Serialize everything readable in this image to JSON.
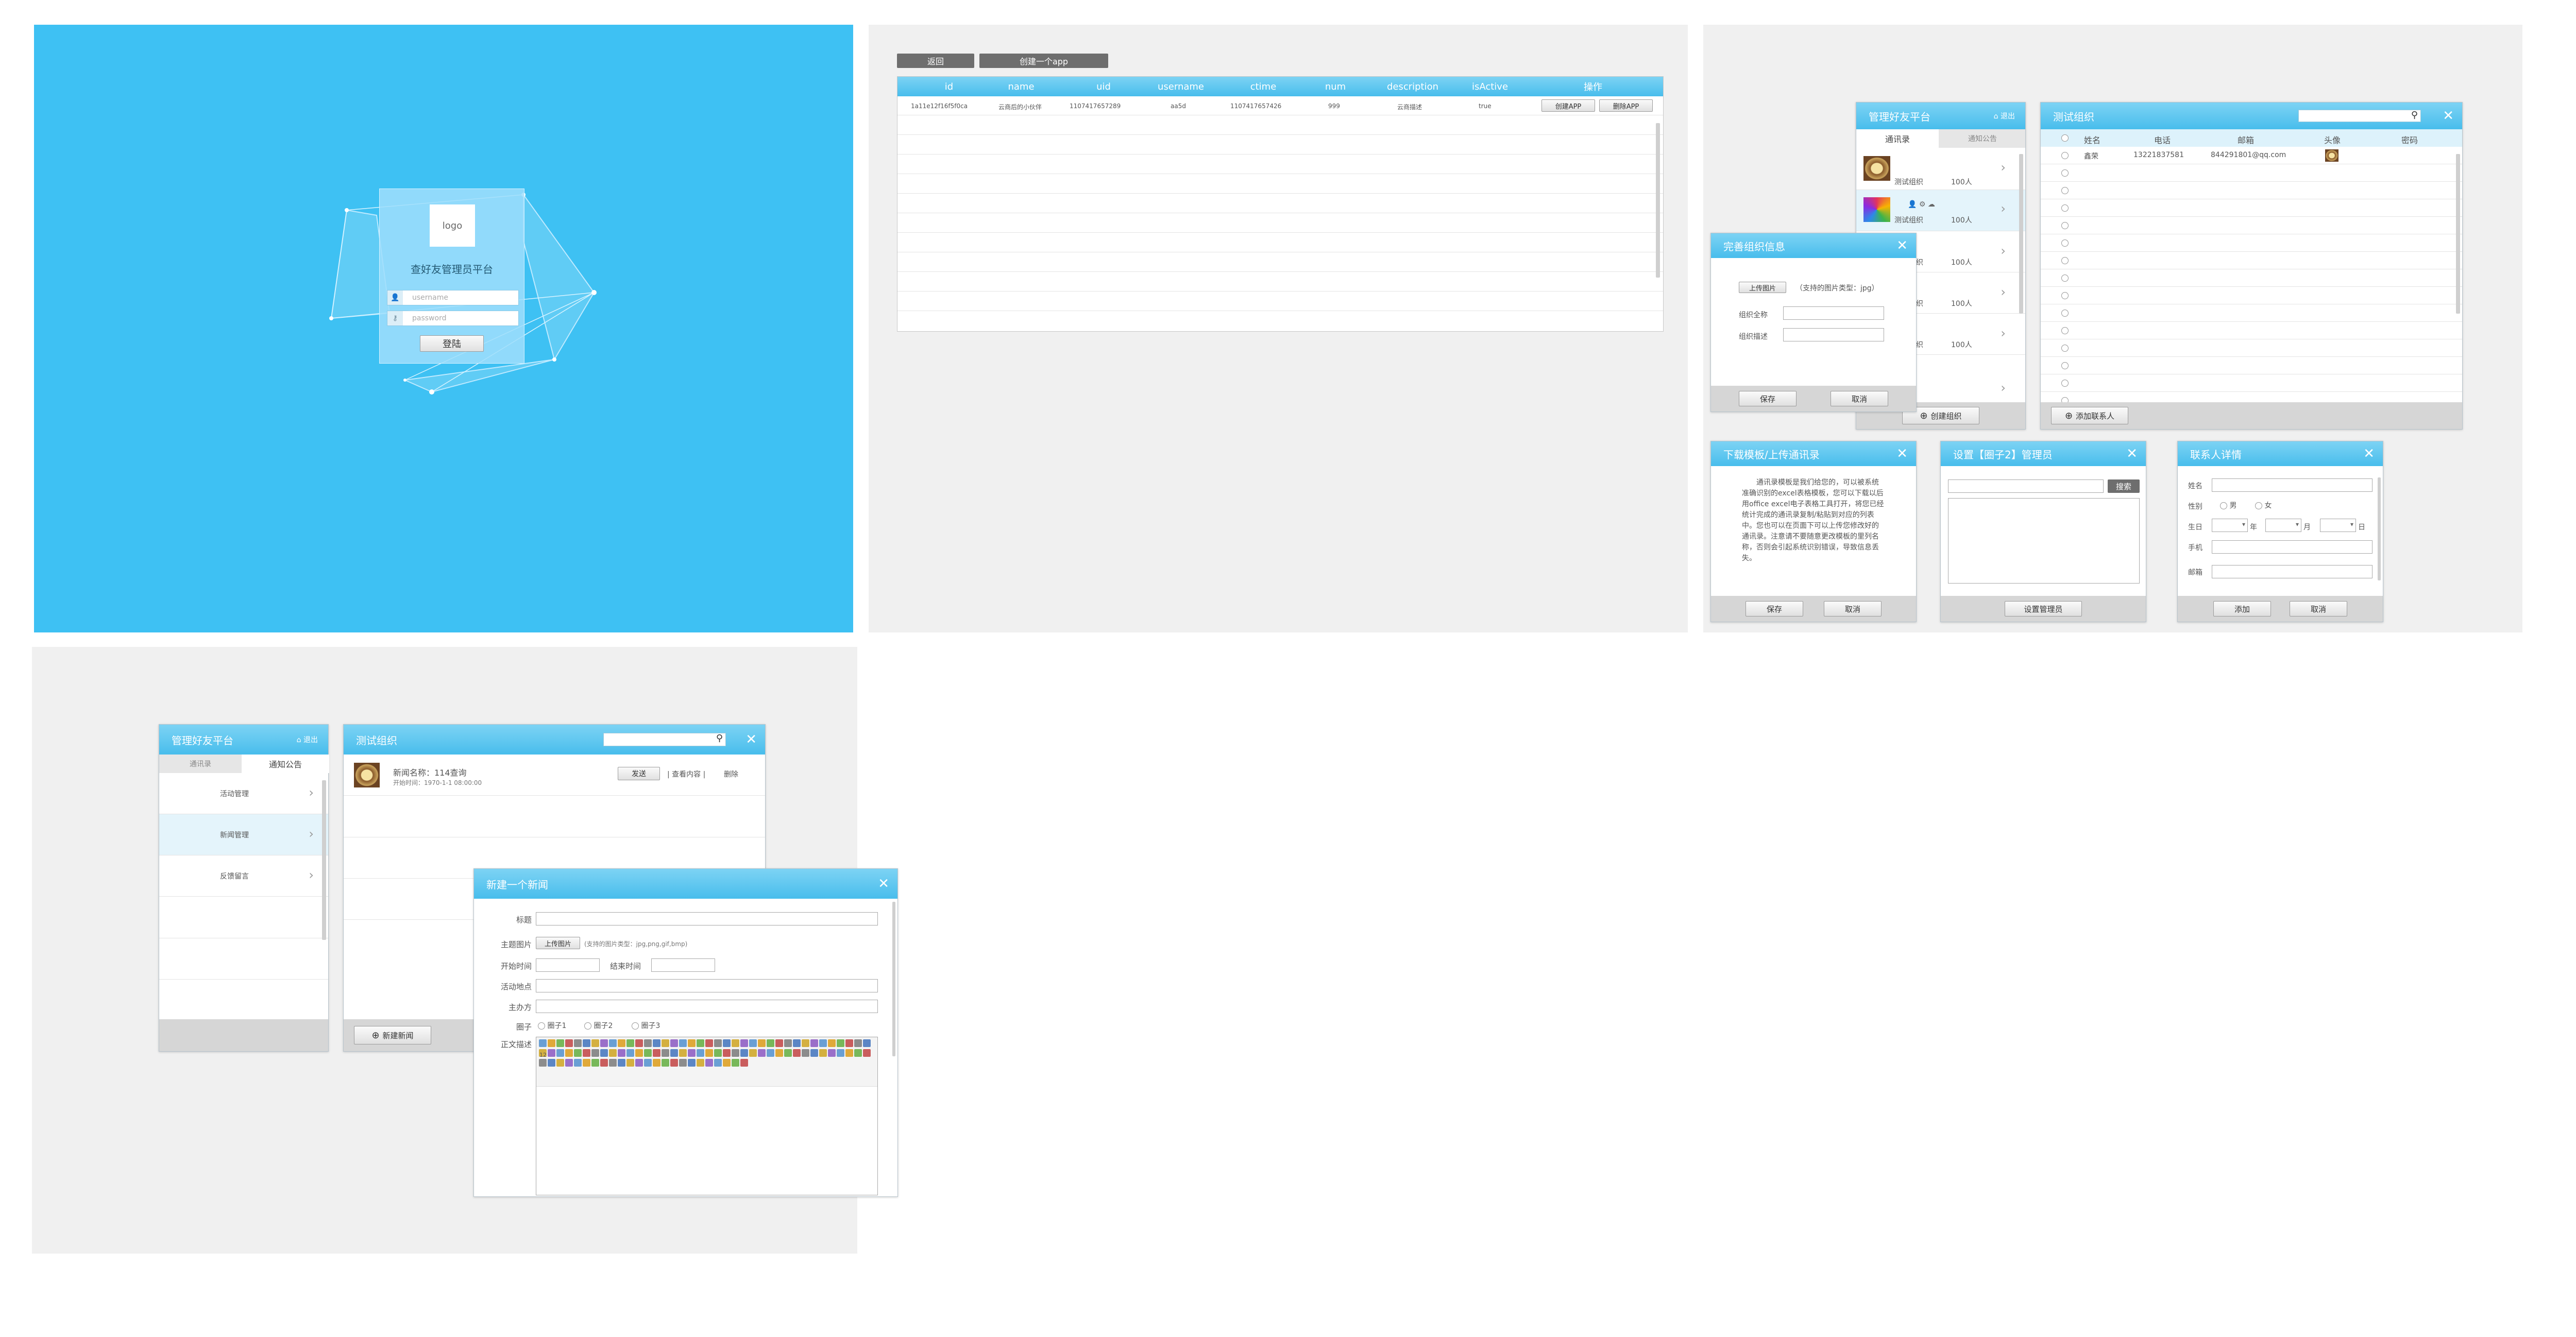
{
  "login": {
    "logo_text": "logo",
    "title": "查好友管理员平台",
    "username_placeholder": "username",
    "password_placeholder": "password",
    "login_button": "登陆"
  },
  "app_table": {
    "back_button": "返回",
    "create_button": "创建一个app",
    "columns": [
      "id",
      "name",
      "uid",
      "username",
      "ctime",
      "num",
      "description",
      "isActive",
      "操作"
    ],
    "row": [
      "1a11e12f16f5f0ca",
      "云商后的小伙伴",
      "1107417657289",
      "aa5d",
      "1107417657426",
      "999",
      "云商描述",
      "true"
    ],
    "row_actions": [
      "创建APP",
      "删除APP"
    ]
  },
  "contacts": {
    "sidebar_title": "管理好友平台",
    "logout": "退出",
    "tabs": [
      "通讯录",
      "通知公告"
    ],
    "orgs": [
      {
        "name": "测试组织",
        "count": "100人"
      },
      {
        "name": "测试组织",
        "count": "100人"
      },
      {
        "name": "测试组织",
        "count": "100人"
      },
      {
        "name": "测试组织",
        "count": "100人"
      },
      {
        "name": "测试组织",
        "count": "100人"
      }
    ],
    "create_org_button": "创建组织",
    "main_title": "测试组织",
    "columns": [
      "姓名",
      "电话",
      "邮箱",
      "头像",
      "密码"
    ],
    "row": {
      "name": "鑫荣",
      "phone": "13221837581",
      "email": "844291801@qq.com"
    },
    "add_contact_button": "添加联系人"
  },
  "org_info_dialog": {
    "title": "完善组织信息",
    "upload_button": "上传图片",
    "upload_hint": "（支持的图片类型：jpg）",
    "fullname_label": "组织全称",
    "desc_label": "组织描述",
    "save": "保存",
    "cancel": "取消"
  },
  "template_dialog": {
    "title": "下载模板/上传通讯录",
    "text": "通讯录模板是我们给您的，可以被系统准确识别的excel表格模板，您可以下载以后用office excel电子表格工具打开，将您已经统计完成的通讯录复制/粘贴到对应的列表中。您也可以在页面下可以上传您修改好的通讯录。注意请不要随意更改模板的里列名称，否则会引起系统识别错误，导致信息丢失。",
    "save": "保存",
    "cancel": "取消"
  },
  "admin_dialog": {
    "title": "设置【圈子2】管理员",
    "search_button": "搜索",
    "set_button": "设置管理员"
  },
  "contact_detail_dialog": {
    "title": "联系人详情",
    "name_label": "姓名",
    "gender_label": "性别",
    "male": "男",
    "female": "女",
    "birthday_label": "生日",
    "year": "年",
    "month": "月",
    "day": "日",
    "mobile_label": "手机",
    "email_label": "邮箱",
    "add": "添加",
    "cancel": "取消"
  },
  "news": {
    "sidebar_title": "管理好友平台",
    "logout": "退出",
    "tabs": [
      "通讯录",
      "通知公告"
    ],
    "menu": [
      "活动管理",
      "新闻管理",
      "反馈留言"
    ],
    "main_title": "测试组织",
    "item_name": "新闻名称：114查询",
    "item_time": "开始时间：1970-1-1 08:00:00",
    "send_button": "发送",
    "view_link": "查看内容",
    "delete_link": "删除",
    "new_news_button": "新建新闻"
  },
  "new_news_dialog": {
    "title": "新建一个新闻",
    "title_label": "标题",
    "image_label": "主题图片",
    "upload_button": "上传图片",
    "upload_hint": "(支持的图片类型：jpg,png,gif,bmp)",
    "start_label": "开始时间",
    "end_label": "结束时间",
    "place_label": "活动地点",
    "host_label": "主办方",
    "circle_label": "圈子",
    "circles": [
      "圈子1",
      "圈子2",
      "圈子3"
    ],
    "body_label": "正文描述",
    "editor_font_size": "12"
  },
  "colors": {
    "accent": "#3ec1f3",
    "header": "#4dbeec",
    "panel_bg": "#f0f0f0"
  }
}
